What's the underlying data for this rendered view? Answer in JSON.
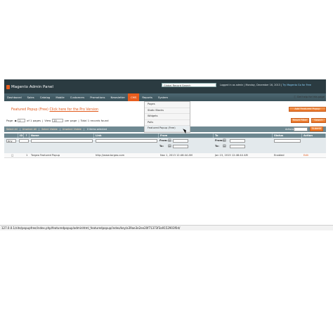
{
  "header": {
    "logo_text": "Magento Admin Panel",
    "search_placeholder": "Global Record Search",
    "user_info": "Logged in as admin  |  Monday, December 16, 2013  |",
    "user_link": "Try Magento Go for Free",
    "help_text": "Get help for this page"
  },
  "nav": {
    "items": [
      "Dashboard",
      "Sales",
      "Catalog",
      "Mobile",
      "Customers",
      "Promotions",
      "Newsletter",
      "CMS",
      "Reports",
      "System"
    ],
    "active_index": 7
  },
  "cms_menu": {
    "items": [
      "Pages",
      "Static Blocks",
      "Widgets",
      "Polls",
      "Featured Popup (Free)"
    ],
    "hover_index": 4
  },
  "page": {
    "title": "Featured Popup (Free)",
    "pro_link": "Click here for the Pro Version",
    "add_button": "Add Featured Popup"
  },
  "pager": {
    "page_label": "Page",
    "page_value": "1",
    "of_pages": "of 1 pages",
    "view_label": "View",
    "per_page_value": "20",
    "per_page_label": "per page",
    "total": "Total 1 records found",
    "reset_button": "Reset Filter",
    "search_button": "Search"
  },
  "massaction": {
    "select_all": "Select All",
    "unselect_all": "Unselect All",
    "select_visible": "Select Visible",
    "unselect_visible": "Unselect Visible",
    "count": "0 items selected",
    "actions_label": "Actions",
    "submit_button": "Submit"
  },
  "grid": {
    "headers": [
      "ID",
      "Name",
      "Link",
      "From",
      "To",
      "Status",
      "Action"
    ],
    "filter_any": "Any",
    "from_label": "From:",
    "to_label": "To:",
    "row": {
      "id": "1",
      "name": "Torgeo Featured Popup",
      "link": "http://www.torgeo.com",
      "from": "Nov 1, 2013 12:46:44 AM",
      "to": "Jan 15, 2015 12:46:44 AM",
      "status": "Enabled",
      "action": "Edit"
    }
  },
  "statusbar": {
    "url": "127.0.0.1/site/popupfree/index.php/featuredpopup/adminhtml_featuredpopup/index/key/a39ae3e2ee20f71373f3a9152903f0d/"
  }
}
